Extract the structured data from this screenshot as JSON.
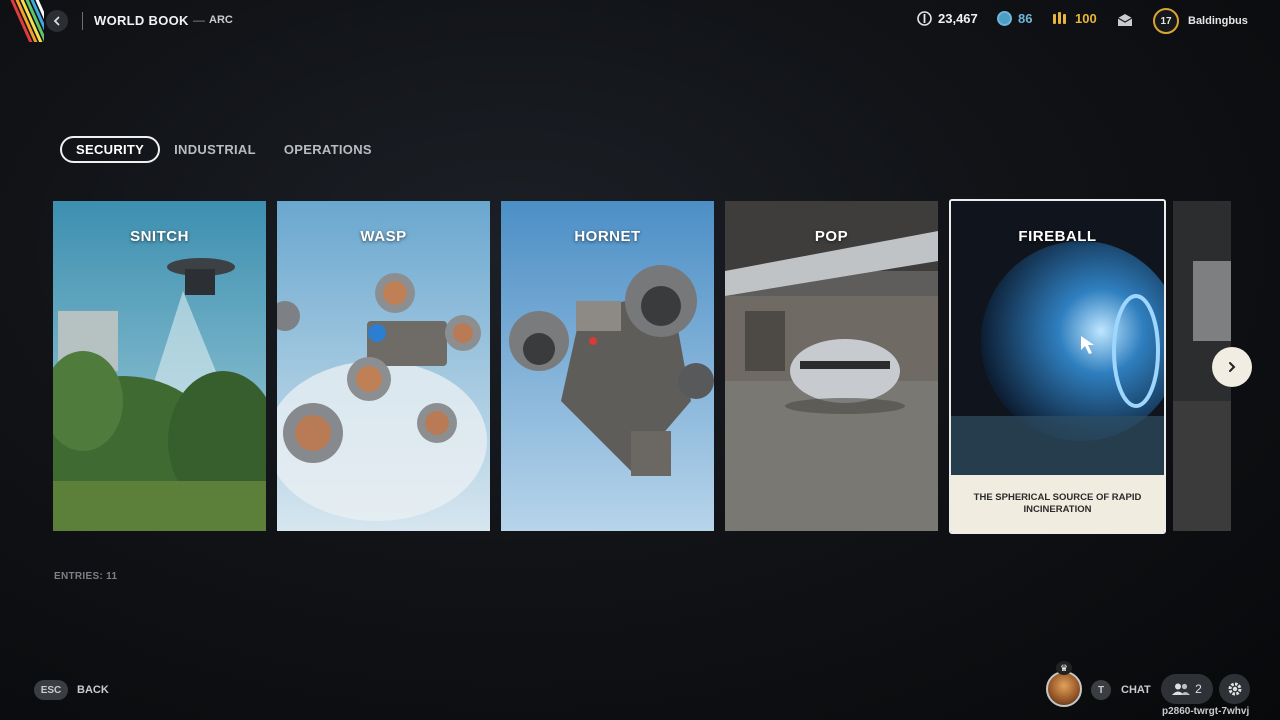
{
  "header": {
    "title": "WORLD BOOK",
    "separator": "—",
    "subtitle": "ARC",
    "currencies": [
      {
        "icon": "coin-icon",
        "value": "23,467",
        "color": "#ffffff"
      },
      {
        "icon": "token-icon",
        "value": "86",
        "color": "#6fb6d8"
      },
      {
        "icon": "credits-icon",
        "value": "100",
        "color": "#e8b53a"
      }
    ],
    "profile": {
      "level": "17",
      "username": "Baldingbus"
    }
  },
  "tabs": [
    {
      "label": "SECURITY",
      "active": true
    },
    {
      "label": "INDUSTRIAL",
      "active": false
    },
    {
      "label": "OPERATIONS",
      "active": false
    }
  ],
  "cards": [
    {
      "title": "SNITCH"
    },
    {
      "title": "WASP"
    },
    {
      "title": "HORNET"
    },
    {
      "title": "POP"
    },
    {
      "title": "FIREBALL",
      "description": "THE SPHERICAL SOURCE OF RAPID INCINERATION",
      "selected": true
    }
  ],
  "entries_label": "ENTRIES: 11",
  "footer": {
    "back_key": "ESC",
    "back_label": "BACK",
    "chat_key": "T",
    "chat_label": "CHAT",
    "party_count": "2",
    "session_id": "p2860-twrgt-7whvj"
  },
  "colors": {
    "accent_gold": "#d9a531",
    "card_description_bg": "#f1ece0"
  }
}
